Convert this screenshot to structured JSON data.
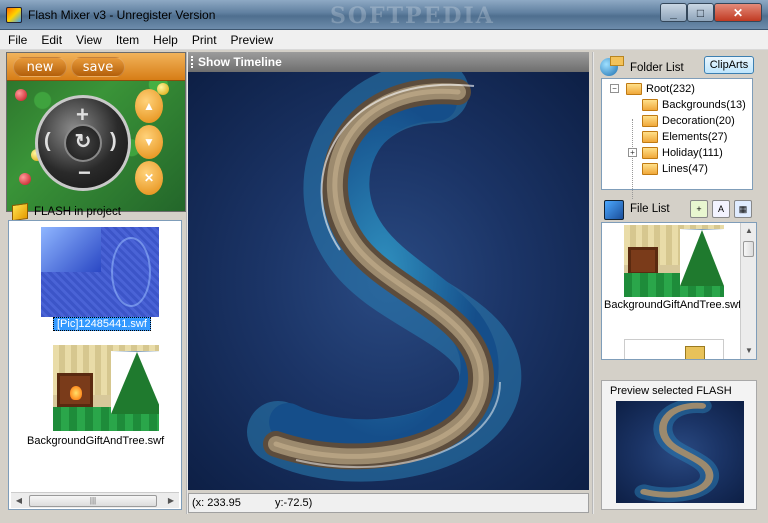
{
  "window": {
    "title": "Flash Mixer v3 - Unregister Version",
    "watermark": "SOFTPEDIA",
    "min_glyph": "_",
    "max_glyph": "□",
    "close_glyph": "✕"
  },
  "menu": [
    "File",
    "Edit",
    "View",
    "Item",
    "Help",
    "Print",
    "Preview"
  ],
  "controls": {
    "new_label": "new",
    "save_label": "save",
    "dial_plus": "+",
    "dial_minus": "−",
    "dial_left": "(",
    "dial_right": ")",
    "dial_center": "↻"
  },
  "project": {
    "label": "FLASH in project",
    "items": [
      {
        "caption": "[Pic]12485441.swf",
        "selected": true
      },
      {
        "caption": "BackgroundGiftAndTree.swf",
        "selected": false
      }
    ],
    "scroll_grip": "|||"
  },
  "timeline": {
    "label": "Show Timeline"
  },
  "status": {
    "x": "(x: 233.95",
    "y": "y:-72.5)"
  },
  "folders": {
    "label": "Folder List",
    "cliparts_label": "ClipArts",
    "root": "Root(232)",
    "items": [
      {
        "label": "Backgrounds(13)",
        "expandable": false
      },
      {
        "label": "Decoration(20)",
        "expandable": false
      },
      {
        "label": "Elements(27)",
        "expandable": false
      },
      {
        "label": "Holiday(111)",
        "expandable": true
      },
      {
        "label": "Lines(47)",
        "expandable": false
      }
    ]
  },
  "files": {
    "label": "File List",
    "items": [
      {
        "caption": "BackgroundGiftAndTree.swf"
      }
    ]
  },
  "preview": {
    "label": "Preview selected FLASH"
  },
  "colors": {
    "ocean": "#1b3466",
    "island_rock": "#8a7660",
    "lagoon": "#1f6f9e",
    "selection": "#3399ff"
  }
}
